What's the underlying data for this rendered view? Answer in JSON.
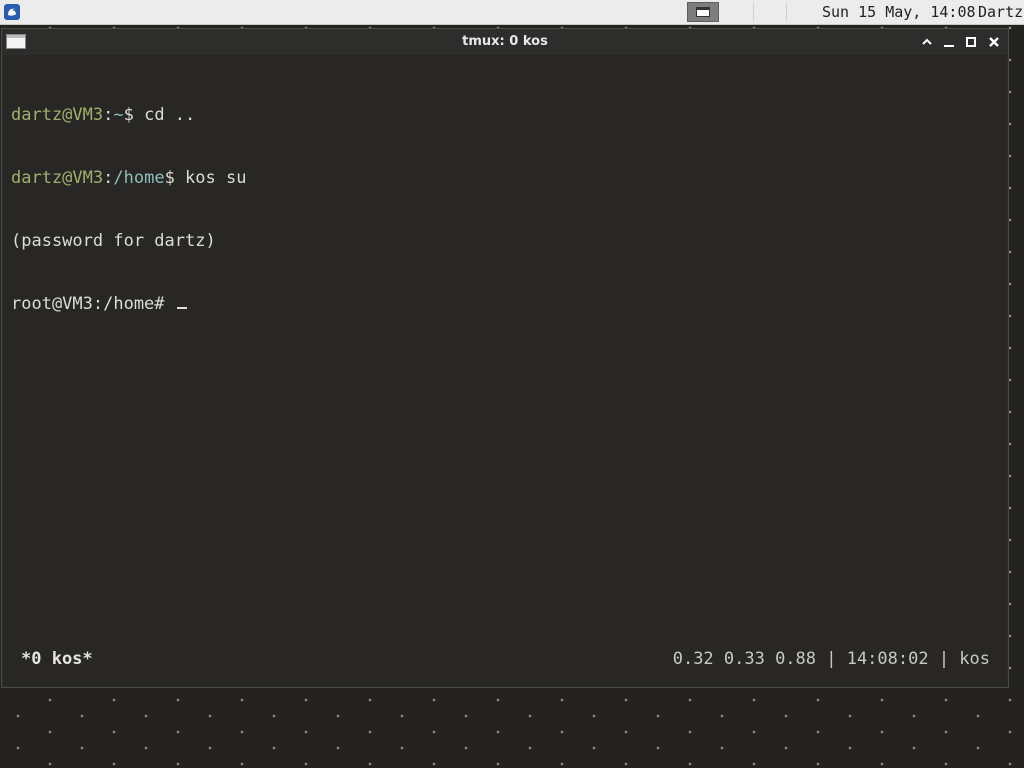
{
  "panel": {
    "clock": "Sun 15 May, 14:08",
    "user": "Dartz",
    "menu_icon": "app-menu-icon",
    "task_icon": "window-icon"
  },
  "window": {
    "title": "tmux: 0 kos",
    "buttons": {
      "shade": "chevron-up-icon",
      "minimize": "minimize-icon",
      "maximize": "maximize-icon",
      "close": "close-icon"
    }
  },
  "terminal": {
    "lines": [
      {
        "user": "dartz@VM3",
        "sep": ":",
        "path": "~",
        "rest": "$ cd .."
      },
      {
        "user": "dartz@VM3",
        "sep": ":",
        "path": "/home",
        "rest": "$ kos su"
      },
      {
        "text": "(password for dartz)"
      },
      {
        "text": "root@VM3:/home# "
      }
    ]
  },
  "tmux": {
    "window_label": "*0 kos*",
    "status_right": "0.32 0.33 0.88 | 14:08:02 | kos"
  },
  "colors": {
    "terminal_bg": "#282725",
    "prompt_user": "#a3ae6a",
    "prompt_path": "#8fbdb9",
    "text": "#dcdcd4"
  }
}
